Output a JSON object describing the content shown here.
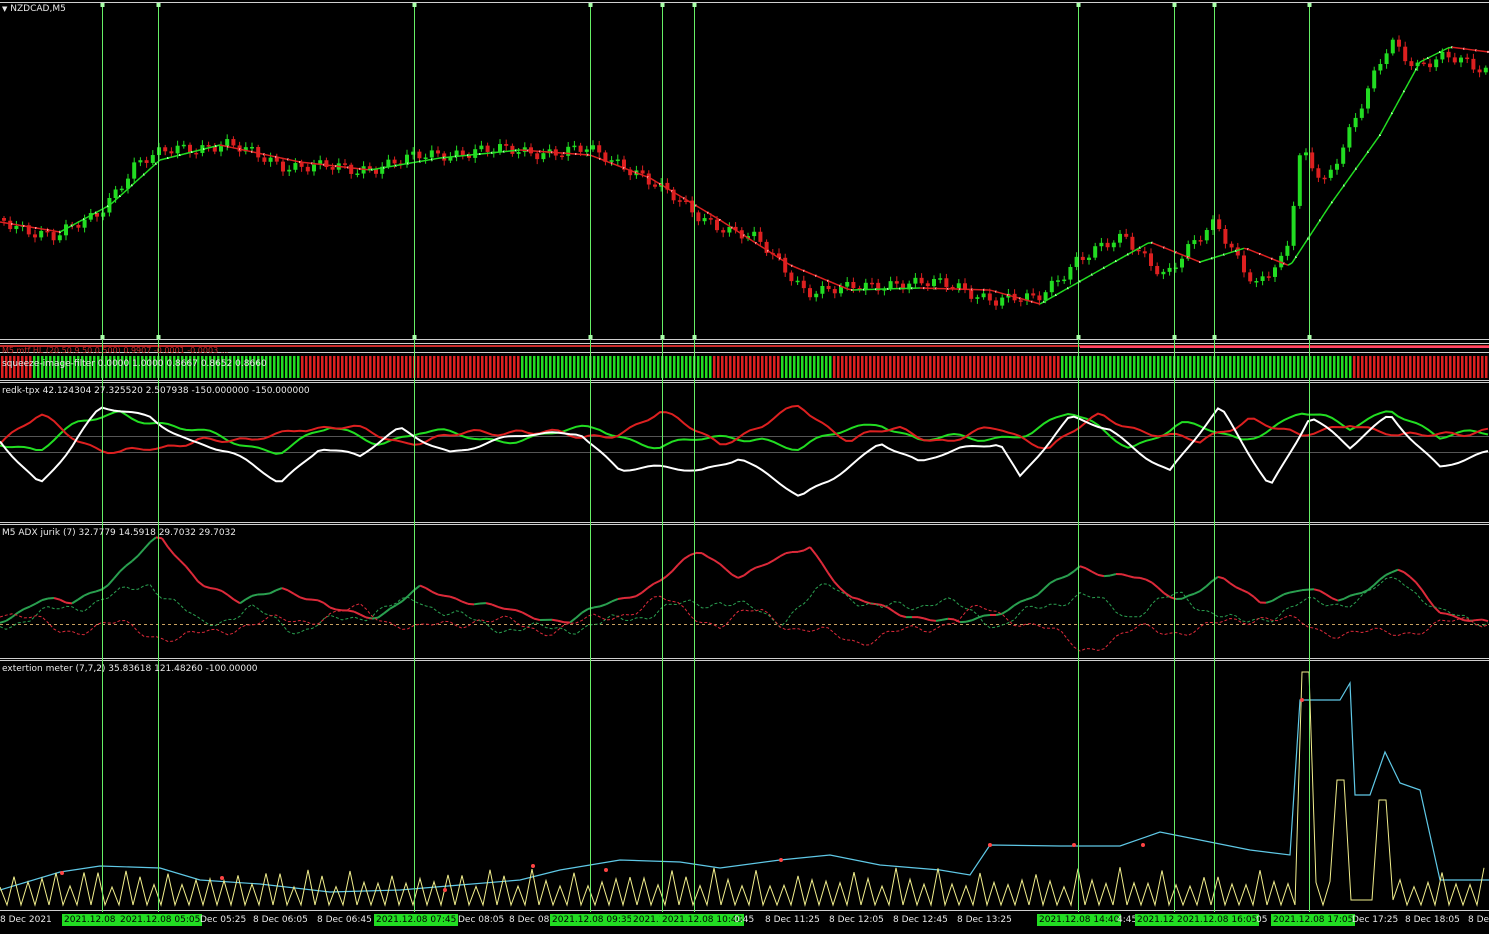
{
  "colors": {
    "background": "#000000",
    "bull": "#22dd22",
    "bear": "#dd2020",
    "vline": "#66ee66",
    "white": "#ffffff",
    "cyan": "#5fc8e6",
    "yellow": "#f2ef8c",
    "adx_green": "#2aa050",
    "adx_red": "#dd2a3a"
  },
  "panes": {
    "main": {
      "symbol": "NZDCAD,M5",
      "collapse_icon": "triangle-down-icon"
    },
    "mtf": {
      "label": "M5 mtf HL (20,50,9,50,0.500) 0.9907 -0.0001 -0.0003 ..."
    },
    "squeeze": {
      "label": "squeeze-image-filter 0.0000 1.0000 0.8667 0.8652 0.8660"
    },
    "redk": {
      "label": "redk-tpx 42.124304 27.325520 2.507938 -150.000000 -150.000000"
    },
    "adx": {
      "label": "M5  ADX jurik (7) 32.7779 14.5918 29.7032 29.7032"
    },
    "ext": {
      "label": "extertion meter (7,7,2) 35.83618 121.48260 -100.00000"
    }
  },
  "time_axis": [
    {
      "text": "8 Dec 2021",
      "hl": false
    },
    {
      "text": "2021.12.08 (",
      "hl": true
    },
    {
      "text": "2021.12.08 05:05",
      "hl": true
    },
    {
      "text": "Dec 05:25",
      "hl": false
    },
    {
      "text": "8 Dec 06:05",
      "hl": false
    },
    {
      "text": "8 Dec 06:45",
      "hl": false
    },
    {
      "text": "2021.12.08 07:45",
      "hl": true
    },
    {
      "text": "Dec 08:05",
      "hl": false
    },
    {
      "text": "8 Dec 08:",
      "hl": false
    },
    {
      "text": "2021.12.08 09:35",
      "hl": true
    },
    {
      "text": "2021.1",
      "hl": true
    },
    {
      "text": "2021.12.08 10:40",
      "hl": true
    },
    {
      "text": "0:45",
      "hl": false
    },
    {
      "text": "8 Dec 11:25",
      "hl": false
    },
    {
      "text": "8 Dec 12:05",
      "hl": false
    },
    {
      "text": "8 Dec 12:45",
      "hl": false
    },
    {
      "text": "8 Dec 13:25",
      "hl": false
    },
    {
      "text": "2021.12.08 14:40",
      "hl": true
    },
    {
      "text": "4:45",
      "hl": false
    },
    {
      "text": "2021.12.",
      "hl": true
    },
    {
      "text": "2021.12.08 16:05",
      "hl": true
    },
    {
      "text": "05",
      "hl": false
    },
    {
      "text": "2021.12.08 17:05",
      "hl": true
    },
    {
      "text": "Dec 17:25",
      "hl": false
    },
    {
      "text": "8 Dec 18:05",
      "hl": false
    },
    {
      "text": "8 De",
      "hl": false
    }
  ]
}
